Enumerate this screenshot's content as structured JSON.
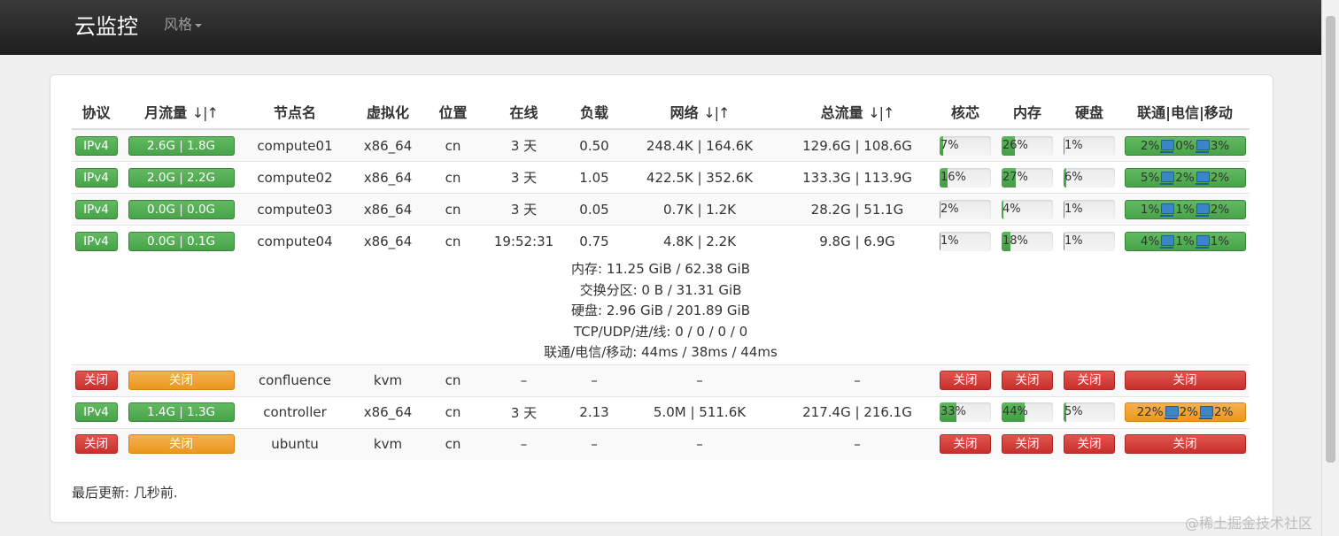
{
  "navbar": {
    "brand": "云监控",
    "style_menu": "风格"
  },
  "table": {
    "headers": {
      "protocol": "协议",
      "monthly_traffic": "月流量",
      "node_name": "节点名",
      "virtualization": "虚拟化",
      "location": "位置",
      "online": "在线",
      "load": "负载",
      "network": "网络",
      "total_traffic": "总流量",
      "cpu": "核芯",
      "memory": "内存",
      "disk": "硬盘",
      "isp": "联通|电信|移动",
      "sort_glyph": "↓|↑"
    },
    "rows": [
      {
        "protocol": "IPv4",
        "traffic": "2.6G | 1.8G",
        "name": "compute01",
        "virt": "x86_64",
        "location": "cn",
        "uptime": "3 天",
        "load": "0.50",
        "network": "248.4K | 164.6K",
        "total": "129.6G | 108.6G",
        "cpu": "7%",
        "cpu_val": 7,
        "mem": "26%",
        "mem_val": 26,
        "disk": "1%",
        "disk_val": 1,
        "isp": [
          "2%",
          "0%",
          "3%"
        ]
      },
      {
        "protocol": "IPv4",
        "traffic": "2.0G | 2.2G",
        "name": "compute02",
        "virt": "x86_64",
        "location": "cn",
        "uptime": "3 天",
        "load": "1.05",
        "network": "422.5K | 352.6K",
        "total": "133.3G | 113.9G",
        "cpu": "16%",
        "cpu_val": 16,
        "mem": "27%",
        "mem_val": 27,
        "disk": "6%",
        "disk_val": 6,
        "isp": [
          "5%",
          "2%",
          "2%"
        ]
      },
      {
        "protocol": "IPv4",
        "traffic": "0.0G | 0.0G",
        "name": "compute03",
        "virt": "x86_64",
        "location": "cn",
        "uptime": "3 天",
        "load": "0.05",
        "network": "0.7K | 1.2K",
        "total": "28.2G | 51.1G",
        "cpu": "2%",
        "cpu_val": 2,
        "mem": "4%",
        "mem_val": 4,
        "disk": "1%",
        "disk_val": 1,
        "isp": [
          "1%",
          "1%",
          "2%"
        ]
      },
      {
        "protocol": "IPv4",
        "traffic": "0.0G | 0.1G",
        "name": "compute04",
        "virt": "x86_64",
        "location": "cn",
        "uptime": "19:52:31",
        "load": "0.75",
        "network": "4.8K | 2.2K",
        "total": "9.8G | 6.9G",
        "cpu": "1%",
        "cpu_val": 1,
        "mem": "18%",
        "mem_val": 18,
        "disk": "1%",
        "disk_val": 1,
        "isp": [
          "4%",
          "1%",
          "1%"
        ]
      },
      {
        "protocol": "关闭",
        "traffic": "关闭",
        "name": "confluence",
        "virt": "kvm",
        "location": "cn",
        "uptime": "–",
        "load": "–",
        "network": "–",
        "total": "–",
        "cpu": "关闭",
        "mem": "关闭",
        "disk": "关闭",
        "isp": "关闭"
      },
      {
        "protocol": "IPv4",
        "traffic": "1.4G | 1.3G",
        "name": "controller",
        "virt": "x86_64",
        "location": "cn",
        "uptime": "3 天",
        "load": "2.13",
        "network": "5.0M | 511.6K",
        "total": "217.4G | 216.1G",
        "cpu": "33%",
        "cpu_val": 33,
        "mem": "44%",
        "mem_val": 44,
        "disk": "5%",
        "disk_val": 5,
        "isp": [
          "22%",
          "2%",
          "2%"
        ]
      },
      {
        "protocol": "关闭",
        "traffic": "关闭",
        "name": "ubuntu",
        "virt": "kvm",
        "location": "cn",
        "uptime": "–",
        "load": "–",
        "network": "–",
        "total": "–",
        "cpu": "关闭",
        "mem": "关闭",
        "disk": "关闭",
        "isp": "关闭"
      }
    ],
    "detail": {
      "memory": "内存: 11.25 GiB / 62.38 GiB",
      "swap": "交换分区: 0 B / 31.31 GiB",
      "disk": "硬盘: 2.96 GiB / 201.89 GiB",
      "tcp_udp": "TCP/UDP/进/线: 0 / 0 / 0 / 0",
      "latency": "联通/电信/移动: 44ms / 38ms / 44ms"
    }
  },
  "footer": {
    "last_update": "最后更新: 几秒前."
  },
  "watermark": "@稀土掘金技术社区",
  "colors": {
    "online": "#5cb85c",
    "offline": "#d9534f",
    "warning": "#f0ad4e",
    "navbar": "#222222"
  }
}
